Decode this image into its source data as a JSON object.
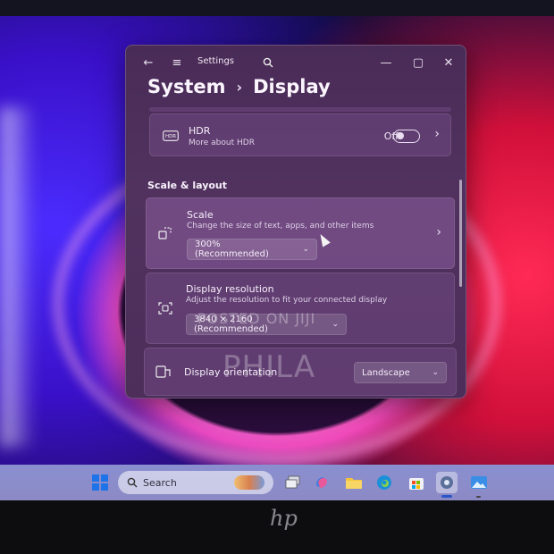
{
  "window": {
    "title": "Settings",
    "breadcrumb": [
      "System",
      "Display"
    ],
    "breadcrumb_sep": "›"
  },
  "icons": {
    "back": "←",
    "menu": "≡",
    "search": "⌕",
    "minimize": "—",
    "maximize": "▢",
    "close": "✕",
    "chevron_right": "›",
    "chevron_down": "⌄"
  },
  "hdr": {
    "title": "HDR",
    "subtitle": "More about HDR",
    "toggle_state": "Off",
    "icon_label": "HDR"
  },
  "section": {
    "heading": "Scale & layout"
  },
  "scale": {
    "title": "Scale",
    "subtitle": "Change the size of text, apps, and other items",
    "value": "300% (Recommended)"
  },
  "resolution": {
    "title": "Display resolution",
    "subtitle": "Adjust the resolution to fit your connected display",
    "value": "3840 × 2160 (Recommended)"
  },
  "orientation": {
    "title": "Display orientation",
    "value": "Landscape"
  },
  "watermark": {
    "line1": "POSTED ON JIJI",
    "line2": "PHILA"
  },
  "taskbar": {
    "search_placeholder": "Search"
  },
  "brand": {
    "logo_text": "hp"
  }
}
